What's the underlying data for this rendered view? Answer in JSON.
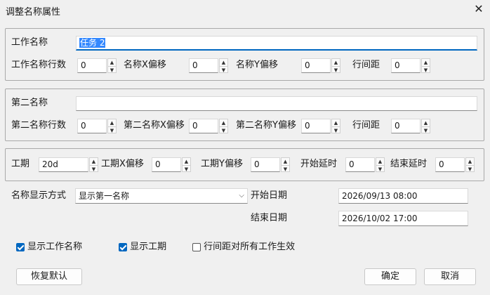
{
  "window": {
    "title": "调整名称属性"
  },
  "group1": {
    "name_label": "工作名称",
    "name_value": "任务 2",
    "rows_label": "工作名称行数",
    "rows_value": "0",
    "xoffset_label": "名称X偏移",
    "xoffset_value": "0",
    "yoffset_label": "名称Y偏移",
    "yoffset_value": "0",
    "linespace_label": "行间距",
    "linespace_value": "0"
  },
  "group2": {
    "name_label": "第二名称",
    "name_value": "",
    "rows_label": "第二名称行数",
    "rows_value": "0",
    "xoffset_label": "第二名称X偏移",
    "xoffset_value": "0",
    "yoffset_label": "第二名称Y偏移",
    "yoffset_value": "0",
    "linespace_label": "行间距",
    "linespace_value": "0"
  },
  "group3": {
    "duration_label": "工期",
    "duration_value": "20d",
    "dur_xoffset_label": "工期X偏移",
    "dur_xoffset_value": "0",
    "dur_yoffset_label": "工期Y偏移",
    "dur_yoffset_value": "0",
    "start_delay_label": "开始延时",
    "start_delay_value": "0",
    "end_delay_label": "结束延时",
    "end_delay_value": "0"
  },
  "display_mode": {
    "label": "名称显示方式",
    "selected": "显示第一名称"
  },
  "dates": {
    "start_label": "开始日期",
    "start_value": "2026/09/13 08:00",
    "end_label": "结束日期",
    "end_value": "2026/10/02 17:00"
  },
  "checkboxes": [
    {
      "label": "显示工作名称",
      "checked": true
    },
    {
      "label": "显示工期",
      "checked": true
    },
    {
      "label": "行间距对所有工作生效",
      "checked": false
    }
  ],
  "buttons": {
    "reset": "恢复默认",
    "ok": "确定",
    "cancel": "取消"
  },
  "colors": {
    "accent": "#0067c0",
    "selection": "#3388ff",
    "background": "#f0f0f0"
  }
}
